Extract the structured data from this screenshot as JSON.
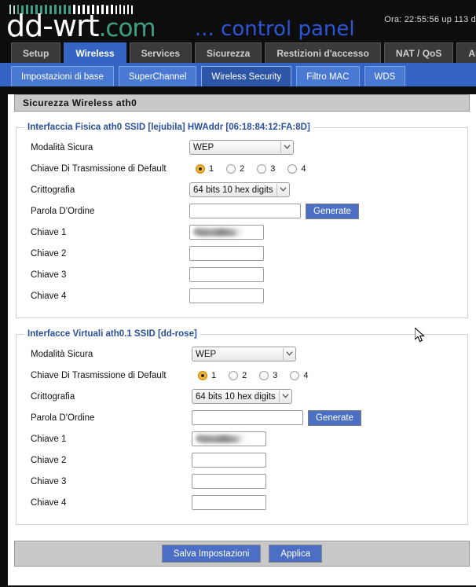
{
  "header": {
    "logo_main": "dd-wrt",
    "logo_suffix": ".com",
    "subtitle": "... control panel",
    "uptime": "Ora: 22:55:56 up 113 d",
    "accent_blue": "#2b56d6",
    "accent_teal": "#3f9e84"
  },
  "main_tabs": [
    {
      "label": "Setup",
      "active": false
    },
    {
      "label": "Wireless",
      "active": true
    },
    {
      "label": "Services",
      "active": false
    },
    {
      "label": "Sicurezza",
      "active": false
    },
    {
      "label": "Restizioni d'accesso",
      "active": false
    },
    {
      "label": "NAT / QoS",
      "active": false
    },
    {
      "label": "Amministrazione",
      "active": false
    }
  ],
  "sub_tabs": [
    {
      "label": "Impostazioni di base",
      "active": false
    },
    {
      "label": "SuperChannel",
      "active": false
    },
    {
      "label": "Wireless Security",
      "active": true
    },
    {
      "label": "Filtro MAC",
      "active": false
    },
    {
      "label": "WDS",
      "active": false
    }
  ],
  "page": {
    "title": "Sicurezza Wireless ath0"
  },
  "sections": [
    {
      "legend": "Interfaccia Fisica ath0 SSID [lejubila] HWAddr [06:18:84:12:FA:8D]",
      "security_mode": {
        "label": "Modalità Sicura",
        "value": "WEP"
      },
      "default_tx_key": {
        "label": "Chiave Di Trasmissione di Default",
        "options": [
          "1",
          "2",
          "3",
          "4"
        ],
        "selected": "1"
      },
      "encryption": {
        "label": "Crittografia",
        "value": "64 bits 10 hex digits"
      },
      "passphrase": {
        "label": "Parola D'Ordine",
        "value": "",
        "placeholder": "",
        "button": "Generate"
      },
      "keys": [
        {
          "label": "Chiave 1",
          "value": "",
          "redacted": true
        },
        {
          "label": "Chiave 2",
          "value": "",
          "redacted": false
        },
        {
          "label": "Chiave 3",
          "value": "",
          "redacted": false
        },
        {
          "label": "Chiave 4",
          "value": "",
          "redacted": false
        }
      ]
    },
    {
      "legend": "Interfacce Virtuali ath0.1 SSID [dd-rose]",
      "security_mode": {
        "label": "Modalità Sicura",
        "value": "WEP"
      },
      "default_tx_key": {
        "label": "Chiave Di Trasmissione di Default",
        "options": [
          "1",
          "2",
          "3",
          "4"
        ],
        "selected": "1"
      },
      "encryption": {
        "label": "Crittografia",
        "value": "64 bits 10 hex digits"
      },
      "passphrase": {
        "label": "Parola D'Ordine",
        "value": "",
        "placeholder": "",
        "button": "Generate"
      },
      "keys": [
        {
          "label": "Chiave 1",
          "value": "",
          "redacted": true
        },
        {
          "label": "Chiave 2",
          "value": "",
          "redacted": false
        },
        {
          "label": "Chiave 3",
          "value": "",
          "redacted": false
        },
        {
          "label": "Chiave 4",
          "value": "",
          "redacted": false
        }
      ]
    }
  ],
  "footer": {
    "save_label": "Salva Impostazioni",
    "apply_label": "Applica"
  },
  "colors": {
    "tab_active": "#3565c4",
    "subtab_bar": "#3565c4",
    "button_blue": "#4a6fc4",
    "legend_blue": "#2a4f9c",
    "radio_selected": "#f0ab22"
  },
  "icons": {
    "dropdown": "chevron-down-icon",
    "cursor": "mouse-pointer-icon"
  }
}
